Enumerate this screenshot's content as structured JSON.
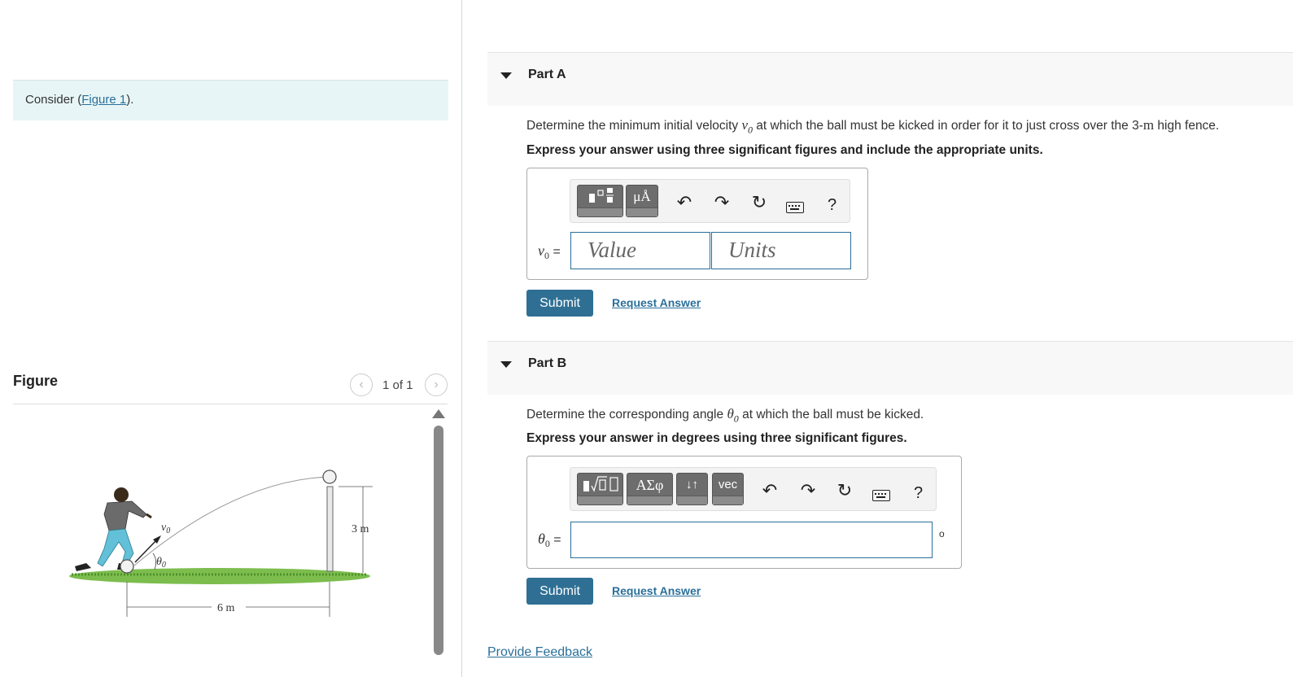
{
  "left": {
    "consider_prefix": "Consider (",
    "consider_link": "Figure 1",
    "consider_suffix": ").",
    "figure_title": "Figure",
    "figure_counter": "1 of 1",
    "figure_labels": {
      "v0": "v",
      "v0_sub": "0",
      "theta": "θ",
      "theta_sub": "0",
      "height": "3 m",
      "distance": "6 m"
    }
  },
  "partA": {
    "title": "Part A",
    "question_pre": "Determine the minimum initial velocity ",
    "question_var": "v",
    "question_var_sub": "0",
    "question_mid": " at which the ball must be kicked in order for it to just cross over the 3-",
    "question_unit": "m",
    "question_post": " high fence.",
    "instruction": "Express your answer using three significant figures and include the appropriate units.",
    "toolbar": {
      "units_button": "μÅ",
      "undo_icon": "↶",
      "redo_icon": "↷",
      "reset_icon": "↻",
      "help": "?"
    },
    "var_label": "v",
    "var_sub": "0",
    "equals": " =",
    "value_placeholder": "Value",
    "units_placeholder": "Units",
    "submit": "Submit",
    "request_answer": "Request Answer"
  },
  "partB": {
    "title": "Part B",
    "question_pre": "Determine the corresponding angle ",
    "question_var": "θ",
    "question_var_sub": "0",
    "question_post": " at which the ball must be kicked.",
    "instruction": "Express your answer in degrees using three significant figures.",
    "toolbar": {
      "symbols_button": "ΑΣφ",
      "arrows_button": "↓↑",
      "vec_button": "vec",
      "undo_icon": "↶",
      "redo_icon": "↷",
      "reset_icon": "↻",
      "help": "?"
    },
    "var_label": "θ",
    "var_sub": "0",
    "equals": " =",
    "answer_value": "",
    "unit_symbol": "o",
    "submit": "Submit",
    "request_answer": "Request Answer"
  },
  "footer": {
    "provide_feedback": "Provide Feedback"
  },
  "colors": {
    "accent": "#2f6f94",
    "link": "#2a6f9a",
    "consider_bg": "#e7f5f6",
    "toolbar_button": "#6d6d6d"
  }
}
